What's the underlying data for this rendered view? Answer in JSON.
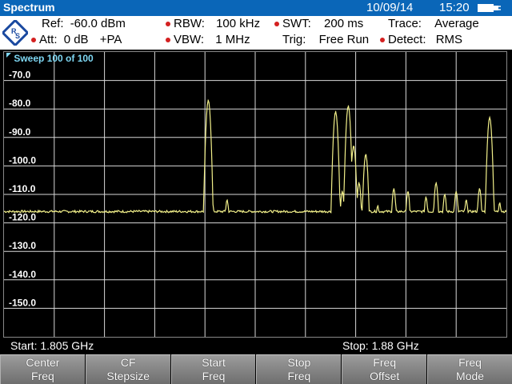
{
  "titlebar": {
    "title": "Spectrum",
    "date": "10/09/14",
    "time": "15:20"
  },
  "params": {
    "ref_label": "Ref:",
    "ref_value": "-60.0 dBm",
    "att_label": "Att:",
    "att_value": "0 dB",
    "pa": "+PA",
    "rbw_label": "RBW:",
    "rbw_value": "100 kHz",
    "vbw_label": "VBW:",
    "vbw_value": "1 MHz",
    "swt_label": "SWT:",
    "swt_value": "200 ms",
    "trig_label": "Trig:",
    "trig_value": "Free Run",
    "trace_label": "Trace:",
    "trace_value": "Average",
    "detect_label": "Detect:",
    "detect_value": "RMS"
  },
  "sweep": {
    "label": "Sweep 100 of 100"
  },
  "status": {
    "start": "Start:  1.805 GHz",
    "stop": "Stop: 1.88 GHz"
  },
  "softkeys": [
    {
      "line1": "Center",
      "line2": "Freq"
    },
    {
      "line1": "CF",
      "line2": "Stepsize"
    },
    {
      "line1": "Start",
      "line2": "Freq"
    },
    {
      "line1": "Stop",
      "line2": "Freq"
    },
    {
      "line1": "Freq",
      "line2": "Offset"
    },
    {
      "line1": "Freq",
      "line2": "Mode"
    }
  ],
  "colors": {
    "title_bg": "#0a66b8",
    "trace": "#f2f08a",
    "grid": "#d8d8d8",
    "sweep_label": "#7fd8f4",
    "bullet": "#d42020"
  },
  "chart_data": {
    "type": "line",
    "xlabel": "",
    "ylabel": "",
    "x_range_ghz": [
      1.805,
      1.88
    ],
    "y_unit": "dBm",
    "ylim": [
      -160,
      -60
    ],
    "y_ticks": [
      "-70.0",
      "-80.0",
      "-90.0",
      "-100.0",
      "-110.0",
      "-120.0",
      "-130.0",
      "-140.0",
      "-150.0"
    ],
    "y_tick_values": [
      -70,
      -80,
      -90,
      -100,
      -110,
      -120,
      -130,
      -140,
      -150
    ],
    "noise_floor_dbm": -116,
    "peaks": [
      {
        "x_ghz": 1.8355,
        "y_dbm": -77
      },
      {
        "x_ghz": 1.8383,
        "y_dbm": -112
      },
      {
        "x_ghz": 1.8545,
        "y_dbm": -81
      },
      {
        "x_ghz": 1.8555,
        "y_dbm": -109
      },
      {
        "x_ghz": 1.8564,
        "y_dbm": -79
      },
      {
        "x_ghz": 1.8572,
        "y_dbm": -93
      },
      {
        "x_ghz": 1.858,
        "y_dbm": -106
      },
      {
        "x_ghz": 1.859,
        "y_dbm": -96
      },
      {
        "x_ghz": 1.8608,
        "y_dbm": -114
      },
      {
        "x_ghz": 1.8632,
        "y_dbm": -108
      },
      {
        "x_ghz": 1.8653,
        "y_dbm": -109
      },
      {
        "x_ghz": 1.868,
        "y_dbm": -111
      },
      {
        "x_ghz": 1.8695,
        "y_dbm": -106
      },
      {
        "x_ghz": 1.8708,
        "y_dbm": -110
      },
      {
        "x_ghz": 1.8725,
        "y_dbm": -109
      },
      {
        "x_ghz": 1.874,
        "y_dbm": -112
      },
      {
        "x_ghz": 1.876,
        "y_dbm": -108
      },
      {
        "x_ghz": 1.8775,
        "y_dbm": -83
      },
      {
        "x_ghz": 1.879,
        "y_dbm": -113
      }
    ]
  }
}
